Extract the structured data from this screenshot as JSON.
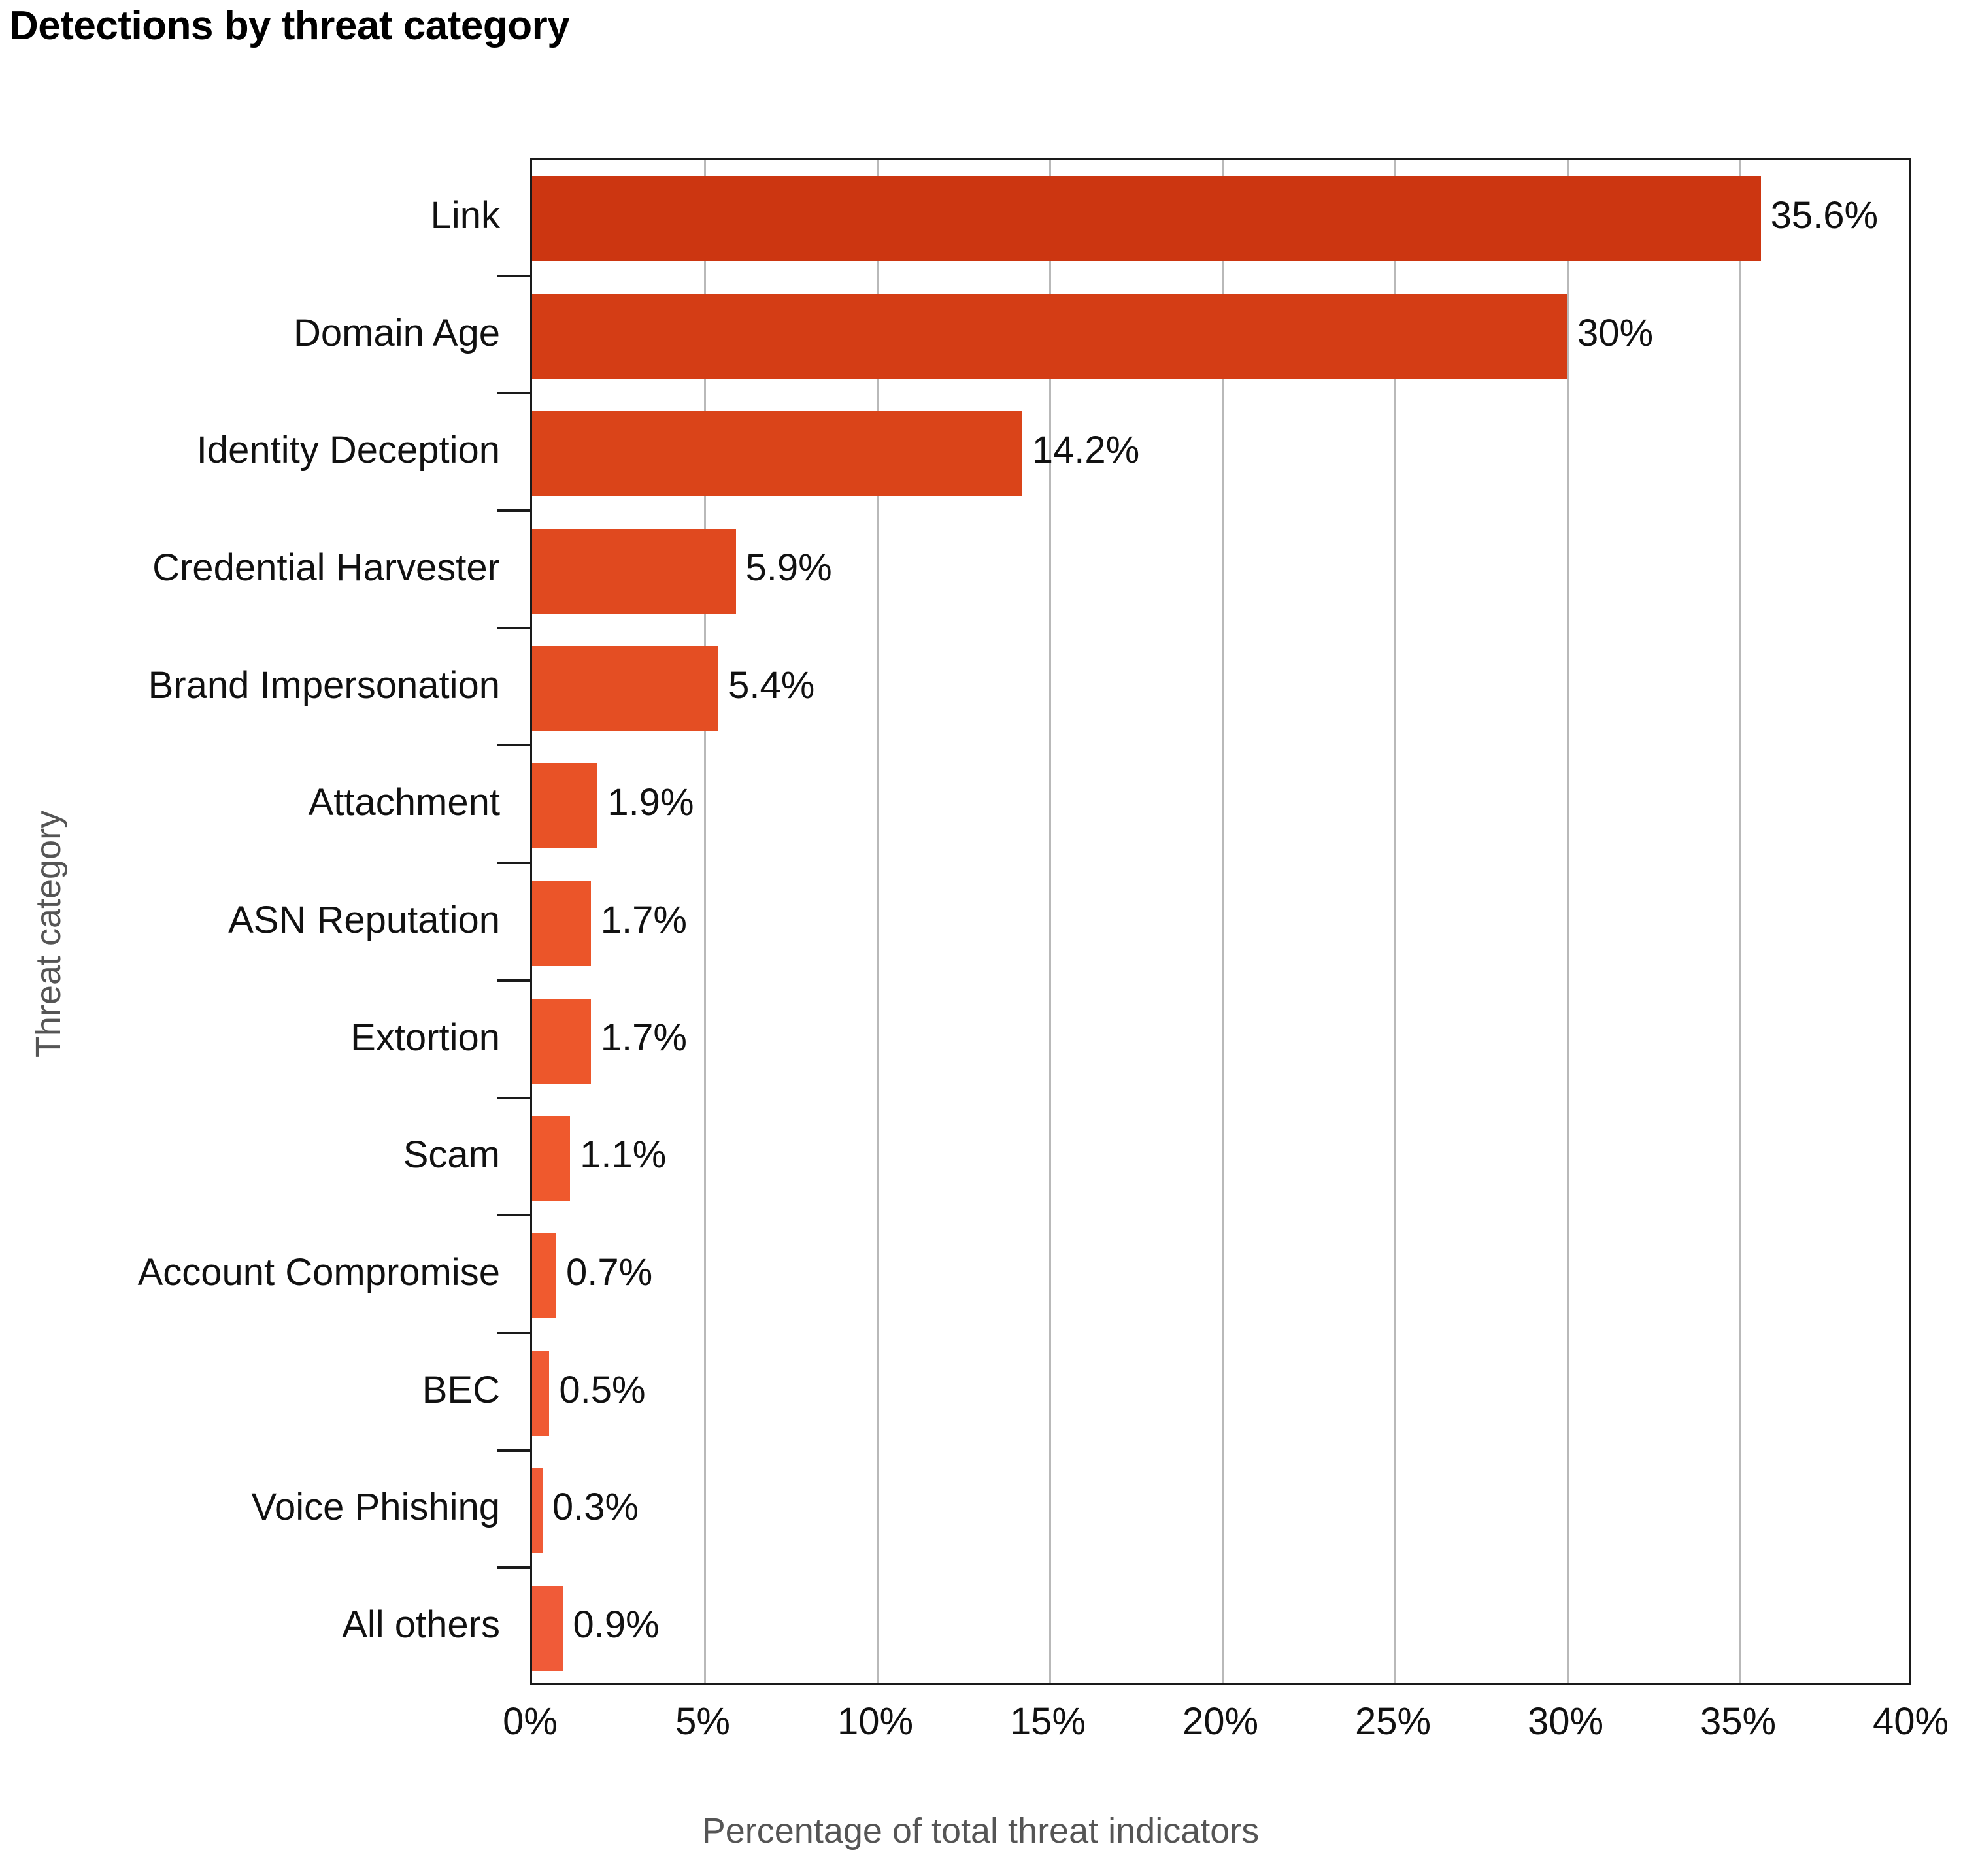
{
  "chart_data": {
    "type": "bar",
    "orientation": "horizontal",
    "title": "Detections by threat category",
    "xlabel": "Percentage of total threat indicators",
    "ylabel": "Threat category",
    "categories": [
      "Link",
      "Domain Age",
      "Identity Deception",
      "Credential Harvester",
      "Brand Impersonation",
      "Attachment",
      "ASN Reputation",
      "Extortion",
      "Scam",
      "Account Compromise",
      "BEC",
      "Voice Phishing",
      "All others"
    ],
    "values": [
      35.6,
      30,
      14.2,
      5.9,
      5.4,
      1.9,
      1.7,
      1.7,
      1.1,
      0.7,
      0.5,
      0.3,
      0.9
    ],
    "value_labels": [
      "35.6%",
      "30%",
      "14.2%",
      "5.9%",
      "5.4%",
      "1.9%",
      "1.7%",
      "1.7%",
      "1.1%",
      "0.7%",
      "0.5%",
      "0.3%",
      "0.9%"
    ],
    "bar_colors": [
      "#cc3611",
      "#d43d15",
      "#da4419",
      "#e0491f",
      "#e44e23",
      "#e85226",
      "#eb5529",
      "#ed572b",
      "#ef592d",
      "#f05a2f",
      "#f05a33",
      "#f05b36",
      "#f05b38"
    ],
    "xlim": [
      0,
      40
    ],
    "x_ticks": [
      0,
      5,
      10,
      15,
      20,
      25,
      30,
      35,
      40
    ],
    "x_tick_labels": [
      "0%",
      "5%",
      "10%",
      "15%",
      "20%",
      "25%",
      "30%",
      "35%",
      "40%"
    ],
    "grid": "vertical",
    "legend": "none",
    "axis_title_color": "#555555",
    "grid_color": "#b9b9b9",
    "frame_color": "#1a1a1a",
    "background": "#ffffff"
  }
}
